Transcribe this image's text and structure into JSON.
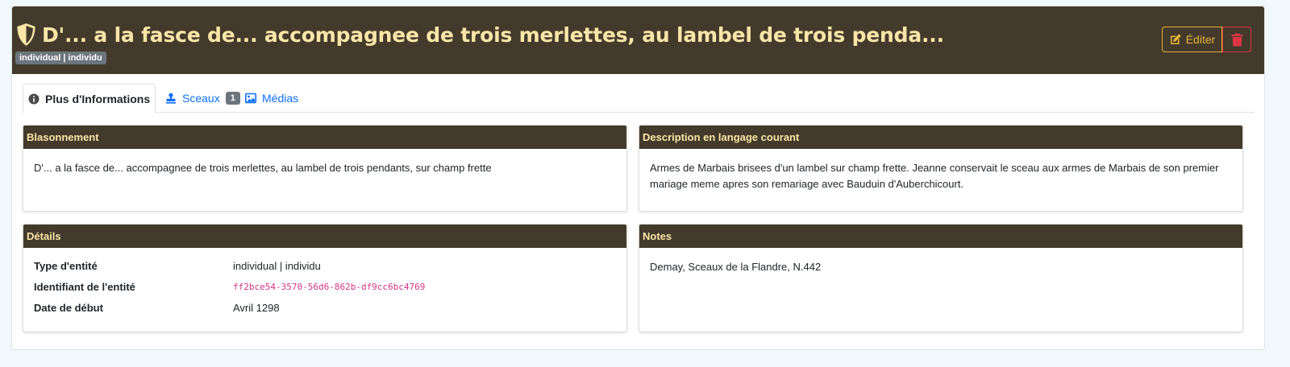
{
  "header": {
    "title": "D'... a la fasce de... accompagnee de trois merlettes, au lambel de trois penda...",
    "type_badge": "individual | individu",
    "edit_label": "Éditer"
  },
  "tabs": [
    {
      "label": "Plus d'Informations"
    },
    {
      "label": "Sceaux",
      "count": "1"
    },
    {
      "label": "Médias"
    }
  ],
  "panels": {
    "blazon": {
      "title": "Blasonnement",
      "text": "D'... a la fasce de... accompagnee de trois merlettes, au lambel de trois pendants, sur champ frette"
    },
    "description": {
      "title": "Description en langage courant",
      "text": "Armes de Marbais brisees d'un lambel sur champ frette. Jeanne conservait le sceau aux armes de Marbais de son premier mariage meme apres son remariage avec Bauduin d'Auberchicourt."
    },
    "details": {
      "title": "Détails",
      "rows": [
        {
          "label": "Type d'entité",
          "value": "individual | individu"
        },
        {
          "label": "Identifiant de l'entité",
          "value": "ff2bce54-3570-56d6-862b-df9cc6bc4769"
        },
        {
          "label": "Date de début",
          "value": "Avril 1298"
        }
      ]
    },
    "notes": {
      "title": "Notes",
      "text": "Demay, Sceaux de la Flandre, N.442"
    }
  },
  "colors": {
    "header_bg": "#433a2b",
    "header_text": "#fbe6a8",
    "edit_accent": "#e8b73a",
    "delete_accent": "#dc3545",
    "link": "#0d6efd"
  }
}
